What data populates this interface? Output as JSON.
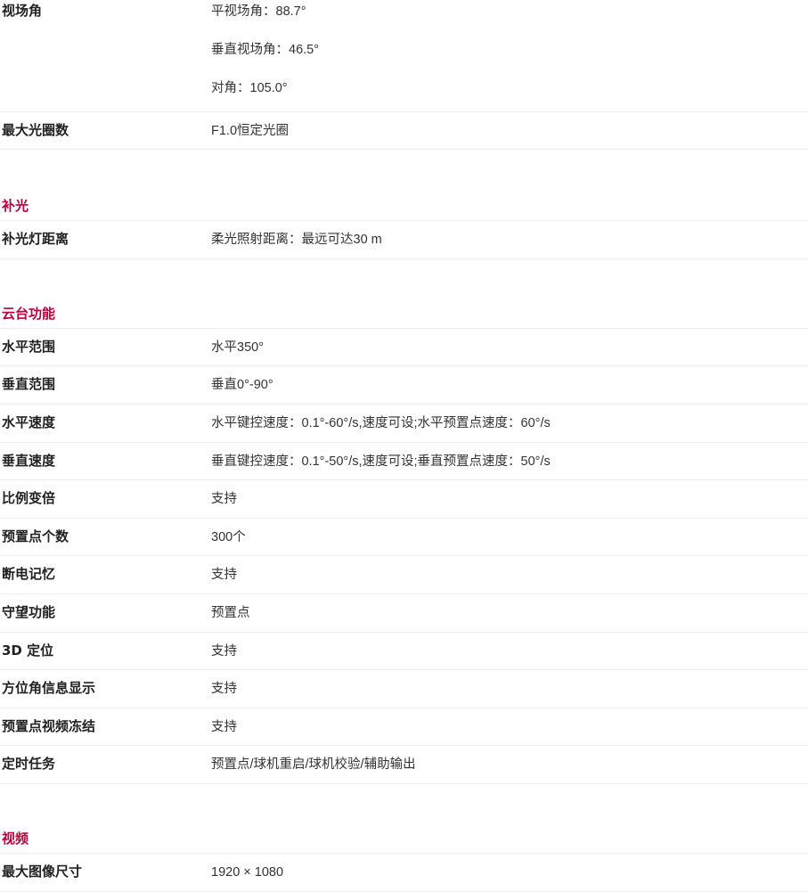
{
  "rows_top": {
    "fov_label": "视场角",
    "fov_values": [
      "平视场角：88.7°",
      "垂直视场角：46.5°",
      "对角：105.0°"
    ],
    "aperture_label": "最大光圈数",
    "aperture_value": "F1.0恒定光圈"
  },
  "sections": {
    "fill_light": {
      "title": "补光",
      "rows": [
        {
          "label": "补光灯距离",
          "value": "柔光照射距离：最远可达30 m"
        }
      ]
    },
    "ptz": {
      "title": "云台功能",
      "rows": [
        {
          "label": "水平范围",
          "value": "水平350°"
        },
        {
          "label": "垂直范围",
          "value": "垂直0°-90°"
        },
        {
          "label": "水平速度",
          "value": "水平键控速度：0.1°-60°/s,速度可设;水平预置点速度：60°/s"
        },
        {
          "label": "垂直速度",
          "value": "垂直键控速度：0.1°-50°/s,速度可设;垂直预置点速度：50°/s"
        },
        {
          "label": "比例变倍",
          "value": "支持"
        },
        {
          "label": "预置点个数",
          "value": "300个"
        },
        {
          "label": "断电记忆",
          "value": "支持"
        },
        {
          "label": "守望功能",
          "value": "预置点"
        },
        {
          "label": "3D 定位",
          "value": "支持"
        },
        {
          "label": "方位角信息显示",
          "value": "支持"
        },
        {
          "label": "预置点视频冻结",
          "value": "支持"
        },
        {
          "label": "定时任务",
          "value": "预置点/球机重启/球机校验/辅助输出"
        }
      ]
    },
    "video": {
      "title": "视频",
      "rows": [
        {
          "label": "最大图像尺寸",
          "value": "1920 × 1080"
        }
      ]
    }
  }
}
